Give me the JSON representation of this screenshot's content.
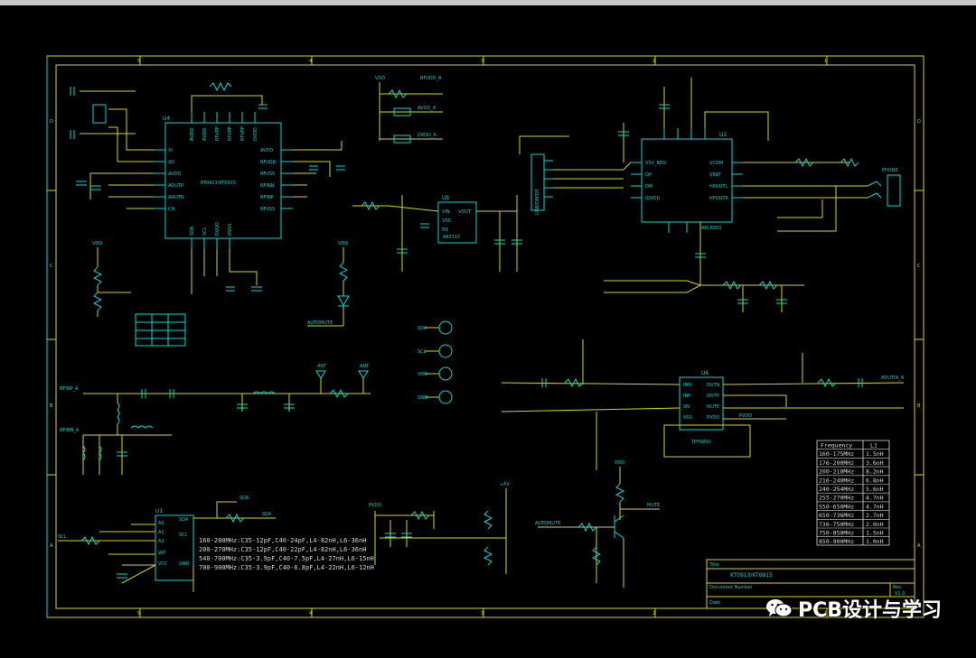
{
  "schematic": {
    "chips": {
      "u4": {
        "ref": "U4",
        "name": "KT0913/KT0915",
        "left_pins": [
          "XI",
          "XO",
          "AVDD",
          "ADUTP",
          "ADUTN",
          "CH"
        ],
        "right_pins": [
          "AVDD",
          "RFVDD",
          "RFVSS",
          "RFINN",
          "RFINP",
          "RFVSS"
        ],
        "top_pins": [
          "AVDD",
          "AVDD",
          "RFVPP",
          "RFVPP",
          "RFVPP",
          "DVDD"
        ],
        "bottom_pins": [
          "SDA",
          "SCL",
          "DVDD",
          "DVSS"
        ]
      },
      "u5": {
        "ref": "U5",
        "name": "AP2112",
        "pins": [
          "VIN",
          "VOUT",
          "VSS",
          "EN"
        ]
      },
      "u2": {
        "ref": "U2",
        "name": "AKC6951",
        "left_pins": [
          "V3V_REG",
          "DP",
          "DM",
          "IOVDD"
        ],
        "right_pins": [
          "VCOM",
          "VREF",
          "HPOUTL",
          "HPOUTR"
        ]
      },
      "u6": {
        "ref": "U6",
        "name": "TPF6850",
        "left_pins": [
          "INN",
          "INP",
          "SN",
          "VSS"
        ],
        "right_pins": [
          "OUTN",
          "OUTP",
          "MUTE",
          "PVDD"
        ]
      },
      "u1": {
        "ref": "U1",
        "name": "24C02",
        "left_pins": [
          "A0",
          "A1",
          "A2",
          "WP",
          "VCC"
        ],
        "right_pins": [
          "SDA",
          "SCL",
          "GND"
        ]
      }
    },
    "connectors": {
      "usb": "USB/DM/DP",
      "jack": "PHONE",
      "ant": "ANT",
      "test_points": [
        "SDA",
        "SCL",
        "VDD",
        "GND"
      ]
    },
    "nets": {
      "rfvdd": "RFVDD_A",
      "avdd": "AVDD_A",
      "dvdd": "DVDD_A",
      "vdd": "VDD",
      "automute": "AUTOMUTE",
      "sda": "SDA",
      "scl": "SCL",
      "ain": "ADUTIN_A",
      "pvdd": "PVDD",
      "mute": "MUTE",
      "plus5v": "+5V",
      "rfinp": "RFINP_A",
      "rfinn": "RFINN_A"
    },
    "band_notes": [
      "160-200MHz:C35-12pF,C40-24pF,L4-82nH,L6-36nH",
      "200-270MHz:C35-12pF,C40-22pF,L4-82nH,L6-36nH",
      "540-700MHz:C35-3.9pF,C40-7.5pF,L4-27nH,L6-15nH",
      "700-900MHz:C35-3.9pF,C40-6.8pF,L4-22nH,L6-12nH"
    ],
    "freq_table": {
      "headers": [
        "Frequency",
        "L1"
      ],
      "rows": [
        [
          "160-175MHz",
          "1.5nH"
        ],
        [
          "176-200MHz",
          "3.6nH"
        ],
        [
          "200-210MHz",
          "8.2nH"
        ],
        [
          "216-240MHz",
          "6.8nH"
        ],
        [
          "240-254MHz",
          "5.6nH"
        ],
        [
          "255-270MHz",
          "4.7nH"
        ],
        [
          "550-650MHz",
          "4.7nH"
        ],
        [
          "650-736MHz",
          "2.7nH"
        ],
        [
          "736-750MHz",
          "2.0nH"
        ],
        [
          "750-850MHz",
          "1.5nH"
        ],
        [
          "850-900MHz",
          "1.0nH"
        ]
      ]
    },
    "title_block": {
      "label": "Title",
      "title": "KT0913/KT0915",
      "doc_label": "Document Number",
      "rev_label": "Rev",
      "rev": "V1.0",
      "date_label": "Date"
    },
    "zone_numbers": [
      "5",
      "4",
      "3",
      "2",
      "1"
    ],
    "zone_letters": [
      "D",
      "C",
      "B",
      "A"
    ]
  },
  "watermark": {
    "text": "PCB设计与学习",
    "icon": "wechat-icon"
  },
  "colors": {
    "background": "#000000",
    "wire": "#d7d700",
    "component": "#00d7d7",
    "text": "#d7d7d7"
  }
}
